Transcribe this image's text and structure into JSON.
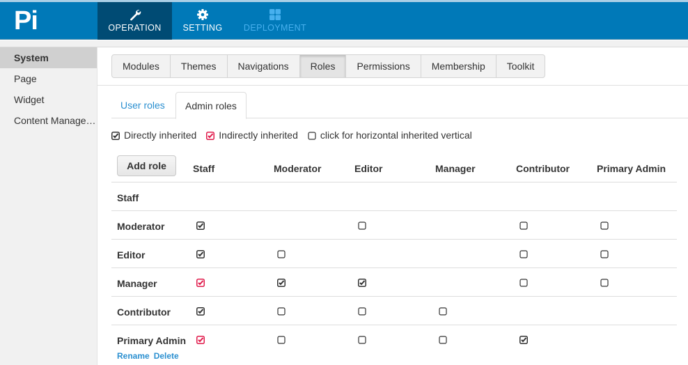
{
  "app": {
    "logo": "Pi"
  },
  "topnav": [
    {
      "label": "OPERATION",
      "icon": "wrench-icon",
      "active": true
    },
    {
      "label": "SETTING",
      "icon": "gear-icon",
      "active": false
    },
    {
      "label": "DEPLOYMENT",
      "icon": "grid-icon",
      "active": false
    }
  ],
  "sidebar": {
    "items": [
      {
        "label": "System",
        "active": true
      },
      {
        "label": "Page",
        "active": false
      },
      {
        "label": "Widget",
        "active": false
      },
      {
        "label": "Content Management",
        "active": false
      }
    ]
  },
  "modules": {
    "buttons": [
      "Modules",
      "Themes",
      "Navigations",
      "Roles",
      "Permissions",
      "Membership",
      "Toolkit"
    ],
    "active": "Roles"
  },
  "tabs": {
    "user_roles": "User roles",
    "admin_roles": "Admin roles",
    "active": "Admin roles"
  },
  "legend": {
    "direct": "Directly inherited",
    "indirect": "Indirectly inherited",
    "toggle": "click for horizontal inherited vertical"
  },
  "colors": {
    "header": "#0079b8",
    "header_active": "#004b74",
    "link": "#2a8fd0",
    "indirect": "#e0194a",
    "direct": "#333333"
  },
  "table": {
    "add_role_label": "Add role",
    "columns": [
      "Staff",
      "Moderator",
      "Editor",
      "Manager",
      "Contributor",
      "Primary Admin"
    ],
    "rows": [
      {
        "name": "Staff",
        "cells": [
          "none",
          "none",
          "none",
          "none",
          "none",
          "none"
        ]
      },
      {
        "name": "Moderator",
        "cells": [
          "direct",
          "none",
          "empty",
          "none",
          "empty",
          "empty"
        ]
      },
      {
        "name": "Editor",
        "cells": [
          "direct",
          "empty",
          "none",
          "none",
          "empty",
          "empty"
        ]
      },
      {
        "name": "Manager",
        "cells": [
          "indirect",
          "direct",
          "direct",
          "none",
          "empty",
          "empty"
        ]
      },
      {
        "name": "Contributor",
        "cells": [
          "direct",
          "empty",
          "empty",
          "empty",
          "none",
          "none"
        ]
      },
      {
        "name": "Primary Admin",
        "cells": [
          "indirect",
          "empty",
          "empty",
          "empty",
          "direct",
          "none"
        ]
      }
    ],
    "row_actions": {
      "rename": "Rename",
      "delete": "Delete"
    }
  }
}
